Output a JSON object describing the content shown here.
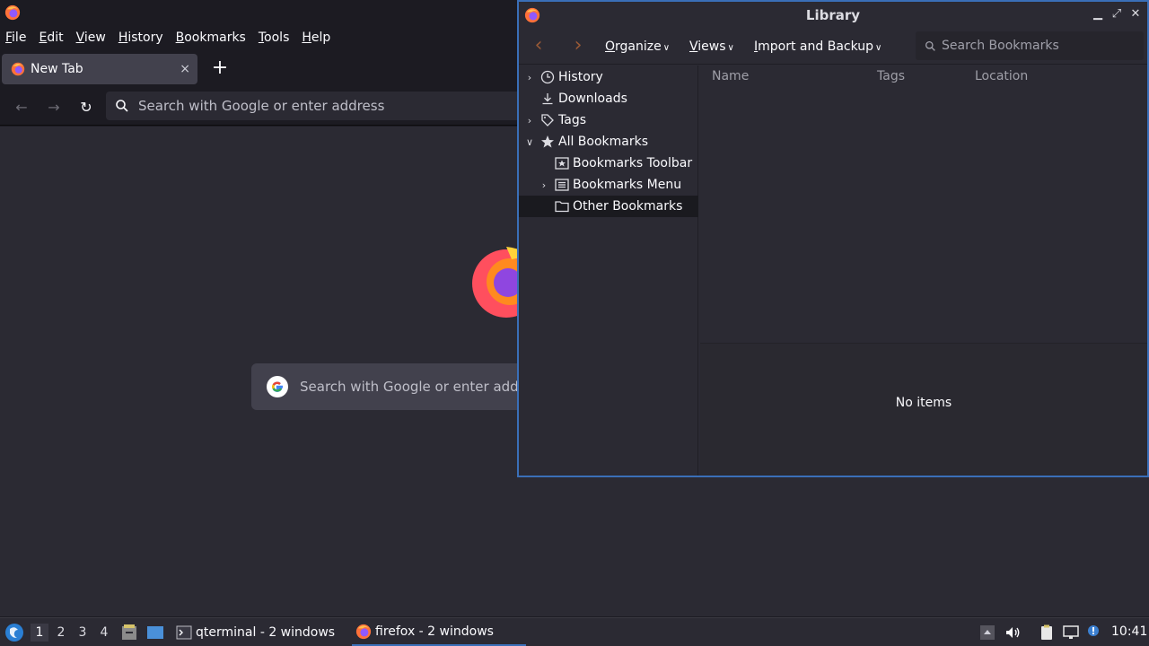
{
  "firefox": {
    "menubar": [
      "File",
      "Edit",
      "View",
      "History",
      "Bookmarks",
      "Tools",
      "Help"
    ],
    "tab_title": "New Tab",
    "tab_close": "×",
    "new_tab": "+",
    "nav": {
      "back": "←",
      "forward": "→",
      "reload": "↻"
    },
    "urlbar_placeholder": "Search with Google or enter address",
    "content_search_placeholder": "Search with Google or enter address"
  },
  "library": {
    "title": "Library",
    "controls": {
      "minimize": "▁",
      "maximize": "⤢",
      "close": "✕"
    },
    "toolbar": {
      "back": "‹",
      "forward": "›",
      "organize": "Organize",
      "views": "Views",
      "import_backup": "Import and Backup",
      "caret": "∨",
      "search_placeholder": "Search Bookmarks"
    },
    "tree": [
      {
        "label": "History",
        "twisty": "›",
        "icon": "clock-icon"
      },
      {
        "label": "Downloads",
        "twisty": "",
        "icon": "download-icon"
      },
      {
        "label": "Tags",
        "twisty": "›",
        "icon": "tag-icon"
      },
      {
        "label": "All Bookmarks",
        "twisty": "∨",
        "icon": "star-icon"
      },
      {
        "label": "Bookmarks Toolbar",
        "twisty": "",
        "icon": "bookmarks-toolbar-icon"
      },
      {
        "label": "Bookmarks Menu",
        "twisty": "›",
        "icon": "bookmarks-menu-icon"
      },
      {
        "label": "Other Bookmarks",
        "twisty": "",
        "icon": "folder-icon",
        "selected": true
      }
    ],
    "columns": [
      "Name",
      "Tags",
      "Location"
    ],
    "empty_text": "No items"
  },
  "taskbar": {
    "workspaces": [
      "1",
      "2",
      "3",
      "4"
    ],
    "active_workspace": "1",
    "tasks": [
      {
        "label": "qterminal - 2 windows",
        "icon": "terminal-icon"
      },
      {
        "label": "firefox - 2 windows",
        "icon": "firefox-icon",
        "active": true
      }
    ],
    "clock": "10:41"
  }
}
